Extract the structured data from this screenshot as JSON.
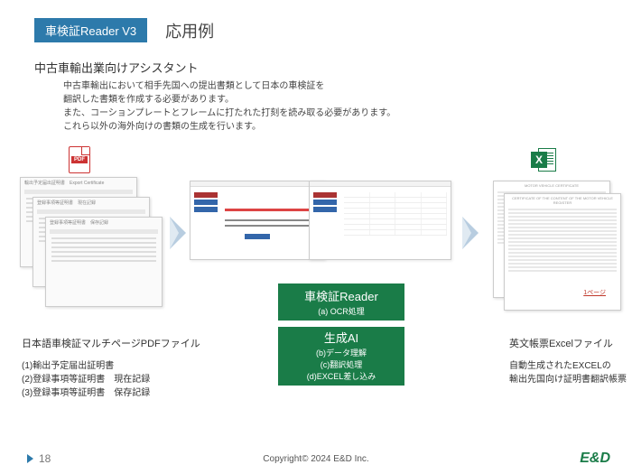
{
  "header": {
    "badge_main": "車検証",
    "badge_suffix": "Reader V3",
    "section_title": "応用例"
  },
  "subtitle": "中古車輸出業向けアシスタント",
  "desc_lines": [
    "中古車輸出において相手先国への提出書類として日本の車検証を",
    "翻訳した書類を作成する必要があります。",
    "また、コーションプレートとフレームに打たれた打刻を読み取る必要があります。",
    "これら以外の海外向けの書類の生成を行います。"
  ],
  "callout1": {
    "title": "車検証Reader",
    "sub": "(a) OCR処理"
  },
  "callout2": {
    "title": "生成AI",
    "subs": [
      "(b)データ理解",
      "(c)翻訳処理",
      "(d)EXCEL差し込み"
    ]
  },
  "left_label": "日本語車検証マルチページPDFファイル",
  "left_list": [
    "(1)輸出予定届出証明書",
    "(2)登録事項等証明書　現在記録",
    "(3)登録事項等証明書　保存記録"
  ],
  "right_label": "英文帳票Excelファイル",
  "right_note": [
    "自動生成されたEXCELの",
    "輸出先国向け証明書翻訳帳票"
  ],
  "excel_page_badge": "1ページ",
  "icons": {
    "pdf": "PDF",
    "excel": "X"
  },
  "footer": {
    "page": "18",
    "copyright": "Copyright© 2024 E&D Inc.",
    "brand": "E&D"
  }
}
